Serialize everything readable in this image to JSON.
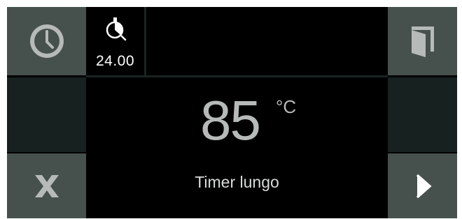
{
  "timer": {
    "value": "24.00",
    "icon": "stopwatch-icon"
  },
  "temperature": {
    "value": "85",
    "unit": "°C"
  },
  "program": {
    "label": "Timer lungo"
  },
  "buttons": {
    "top_left_icon": "clock-icon",
    "top_right_icon": "door-icon",
    "bottom_left_icon": "cancel-icon",
    "bottom_right_icon": "play-icon"
  },
  "colors": {
    "panel_background": "#000000",
    "button_background": "#46504d",
    "filler_background": "#17211f",
    "icon_color": "#b6bab8",
    "text_color": "#d8dcda"
  }
}
